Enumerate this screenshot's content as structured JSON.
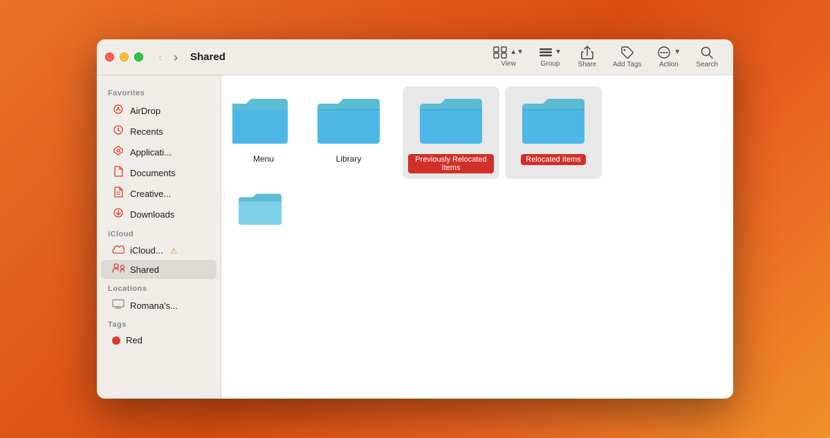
{
  "window": {
    "title": "Shared"
  },
  "titlebar": {
    "back_label": "‹",
    "forward_label": "›",
    "nav_label": "Back/Forward"
  },
  "toolbar": {
    "view_label": "View",
    "group_label": "Group",
    "share_label": "Share",
    "add_tags_label": "Add Tags",
    "action_label": "Action",
    "search_label": "Search"
  },
  "sidebar": {
    "favorites_label": "Favorites",
    "icloud_label": "iCloud",
    "locations_label": "Locations",
    "tags_label": "Tags",
    "items": [
      {
        "id": "airdrop",
        "label": "AirDrop",
        "icon": "airdrop"
      },
      {
        "id": "recents",
        "label": "Recents",
        "icon": "recents"
      },
      {
        "id": "applications",
        "label": "Applicati...",
        "icon": "applications"
      },
      {
        "id": "documents",
        "label": "Documents",
        "icon": "documents"
      },
      {
        "id": "creative",
        "label": "Creative...",
        "icon": "creative"
      },
      {
        "id": "downloads",
        "label": "Downloads",
        "icon": "downloads"
      }
    ],
    "icloud_items": [
      {
        "id": "icloud-drive",
        "label": "iCloud...",
        "icon": "icloud",
        "warning": true
      },
      {
        "id": "shared",
        "label": "Shared",
        "icon": "shared",
        "active": true
      }
    ],
    "location_items": [
      {
        "id": "romanas",
        "label": "Romana's...",
        "icon": "computer"
      }
    ],
    "tag_items": [
      {
        "id": "red",
        "label": "Red",
        "color": "#e0392b"
      }
    ]
  },
  "folders": [
    {
      "id": "folder-menu",
      "label": "Menu",
      "type": "normal",
      "partial": true
    },
    {
      "id": "folder-library",
      "label": "Library",
      "type": "normal"
    },
    {
      "id": "folder-previously-relocated",
      "label": "Previously Relocated Items",
      "type": "highlighted",
      "badge": true
    },
    {
      "id": "folder-relocated",
      "label": "Relocated Items",
      "type": "highlighted",
      "badge": true
    },
    {
      "id": "folder-partial-bottom",
      "label": "",
      "type": "partial-bottom"
    }
  ]
}
